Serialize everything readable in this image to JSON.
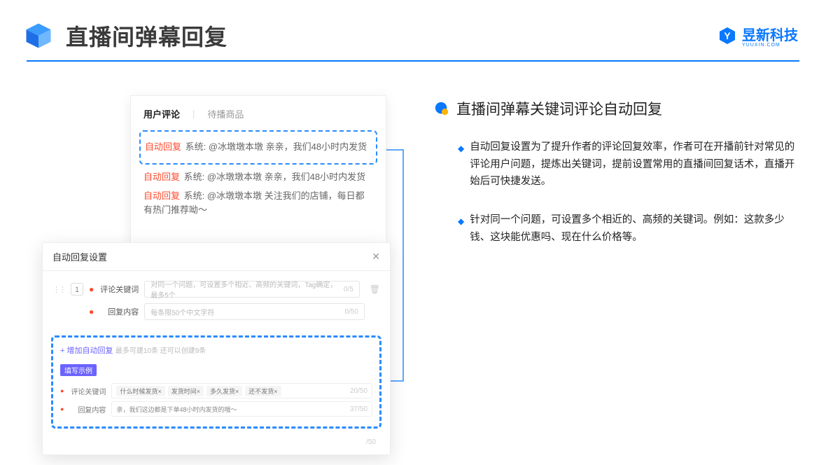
{
  "header": {
    "title": "直播间弹幕回复",
    "brand_name": "昱新科技",
    "brand_sub": "YUUXIN.COM"
  },
  "right": {
    "section_title": "直播间弹幕关键词评论自动回复",
    "bullet1": "自动回复设置为了提升作者的评论回复效率，作者可在开播前针对常见的评论用户问题，提炼出关键词，提前设置常用的直播间回复话术，直播开始后可快捷发送。",
    "bullet2": "针对同一个问题，可设置多个相近的、高频的关键词。例如：这款多少钱、这块能优惠吗、现在什么价格等。"
  },
  "comments": {
    "tab_active": "用户评论",
    "tab_inactive": "待播商品",
    "highlighted": "系统: @冰墩墩本墩 亲亲，我们48小时内发货",
    "line2": "系统: @冰墩墩本墩 亲亲，我们48小时内发货",
    "line3": "系统: @冰墩墩本墩 关注我们的店铺，每日都有热门推荐呦～",
    "tag": "自动回复"
  },
  "settings": {
    "title": "自动回复设置",
    "row_num": "1",
    "label_keyword": "评论关键词",
    "placeholder_keyword": "对同一个问题，可设置多个相近、高频的关键词，Tag确定，最多5个",
    "count_keyword": "0/5",
    "label_content": "回复内容",
    "placeholder_content": "每条限50个中文字符",
    "count_content": "0/50",
    "add_link": "+ 增加自动回复",
    "add_note": "最多可建10条 还可以创建9条",
    "badge": "填写示例",
    "ex_label_kw": "评论关键词",
    "chips": [
      "什么时候发货×",
      "发货时间×",
      "多久发货×",
      "还不发货×"
    ],
    "ex_kw_count": "20/50",
    "ex_label_ct": "回复内容",
    "ex_content": "亲，我们这边都是下单48小时内发货的哦～",
    "ex_ct_count": "37/50",
    "faded_count": "/50"
  }
}
